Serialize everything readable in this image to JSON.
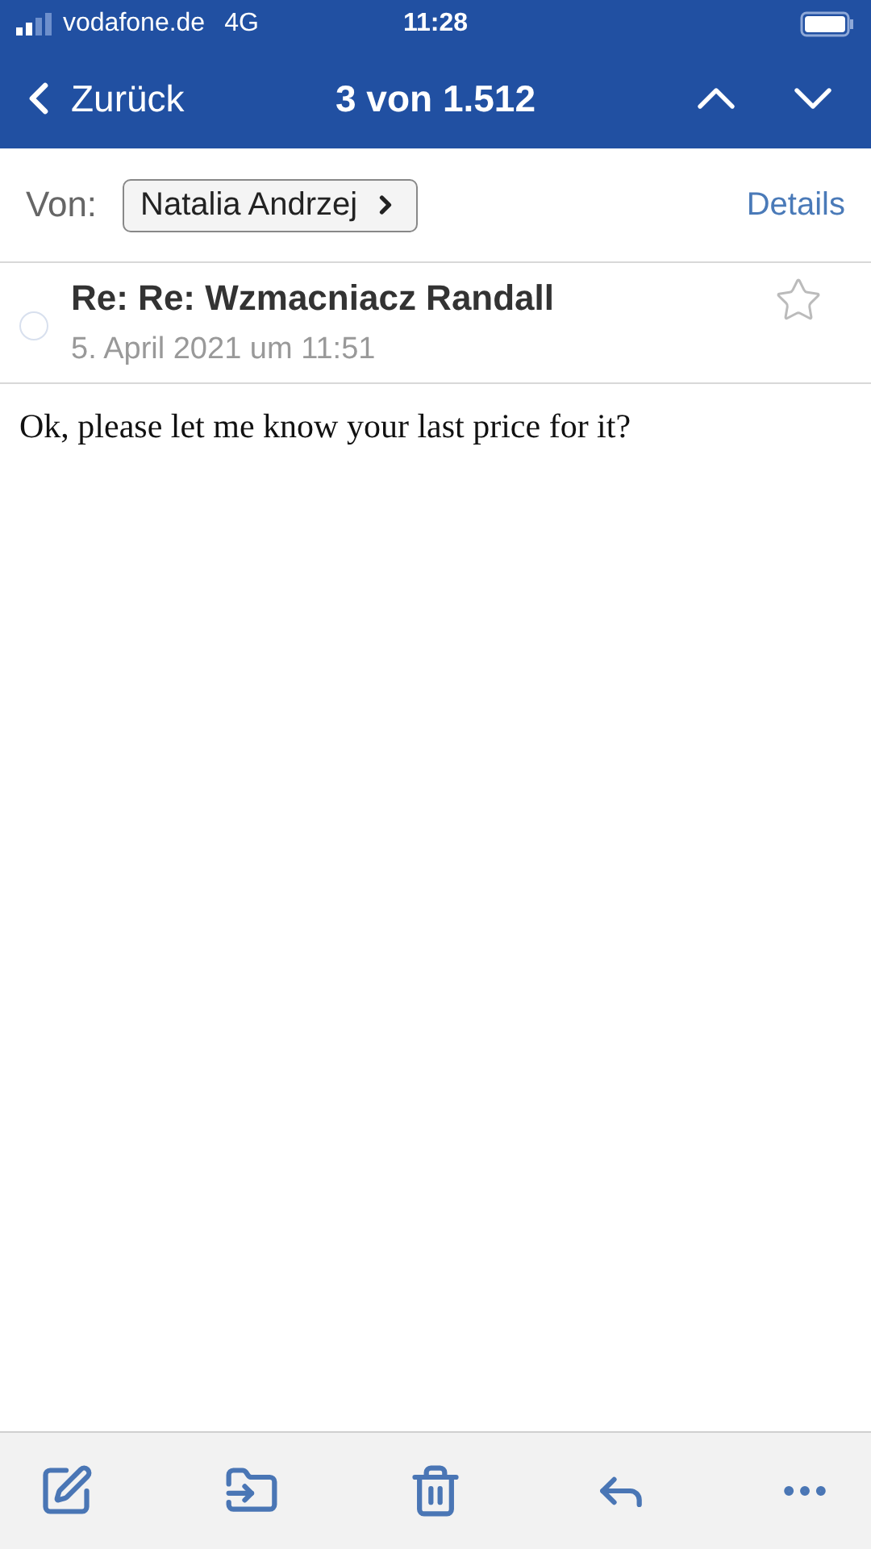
{
  "status_bar": {
    "carrier": "vodafone.de",
    "network": "4G",
    "time": "11:28"
  },
  "nav": {
    "back": "Zurück",
    "title": "3 von 1.512"
  },
  "header": {
    "from_label": "Von:",
    "sender": "Natalia Andrzej",
    "details": "Details"
  },
  "message": {
    "subject": "Re: Re: Wzmacniacz Randall",
    "date": "5. April 2021 um 11:51",
    "starred": false,
    "body": "Ok, please let me know your last price for it?"
  },
  "toolbar": [
    {
      "kind": "compose"
    },
    {
      "kind": "move"
    },
    {
      "kind": "delete"
    },
    {
      "kind": "reply"
    },
    {
      "kind": "more"
    }
  ]
}
